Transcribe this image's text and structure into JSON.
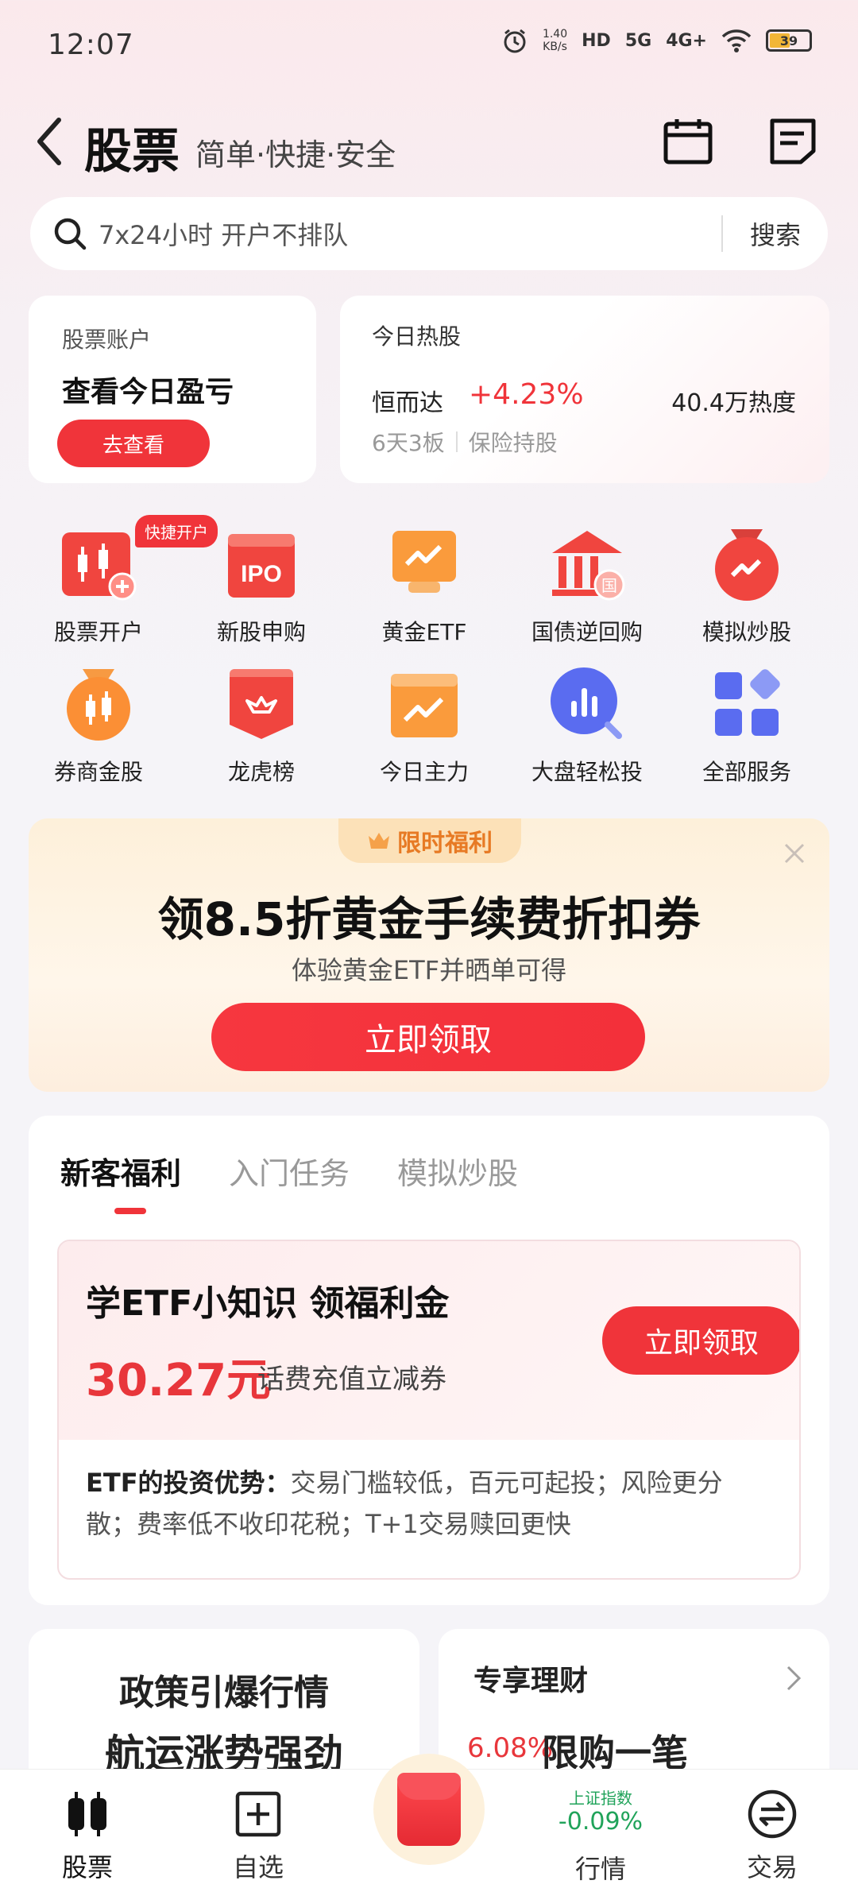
{
  "status_bar": {
    "time": "12:07",
    "net_speed": "1.40",
    "net_unit": "KB/s",
    "hd": "HD",
    "signal_5g": "5G",
    "signal_4g": "4G+",
    "battery": "39"
  },
  "header": {
    "title": "股票",
    "subtitle": "简单·快捷·安全"
  },
  "search": {
    "placeholder": "7x24小时 开户不排队",
    "button": "搜索"
  },
  "account_card": {
    "label": "股票账户",
    "value": "查看今日盈亏",
    "button": "去查看"
  },
  "hot_card": {
    "label": "今日热股",
    "stock_name": "恒而达",
    "change": "+4.23%",
    "heat": "40.4万热度",
    "streak": "6天3板",
    "tag": "保险持股"
  },
  "services": [
    {
      "label": "股票开户",
      "badge": "快捷开户",
      "icon": "candlestick-icon"
    },
    {
      "label": "新股申购",
      "icon": "ipo-icon",
      "icon_text": "IPO"
    },
    {
      "label": "黄金ETF",
      "icon": "gold-etf-icon"
    },
    {
      "label": "国债逆回购",
      "icon": "treasury-icon",
      "icon_text": "国"
    },
    {
      "label": "模拟炒股",
      "icon": "simulated-trading-icon"
    },
    {
      "label": "券商金股",
      "icon": "broker-stock-icon"
    },
    {
      "label": "龙虎榜",
      "icon": "dragon-tiger-icon"
    },
    {
      "label": "今日主力",
      "icon": "main-force-icon"
    },
    {
      "label": "大盘轻松投",
      "icon": "market-invest-icon"
    },
    {
      "label": "全部服务",
      "icon": "all-services-icon"
    }
  ],
  "promo": {
    "tab": "限时福利",
    "headline": "领8.5折黄金手续费折扣券",
    "sub": "体验黄金ETF并晒单可得",
    "button": "立即领取"
  },
  "welfare": {
    "tabs": [
      "新客福利",
      "入门任务",
      "模拟炒股"
    ],
    "title": "学ETF小知识 领福利金",
    "amount": "30.27元",
    "amount_note": "话费充值立减券",
    "button": "立即领取",
    "desc_bold": "ETF的投资优势：",
    "desc": "交易门槛较低，百元可起投；风险更分散；费率低不收印花税；T+1交易赎回更快"
  },
  "policy_card": {
    "line1": "政策引爆行情",
    "line2": "航运涨势强劲"
  },
  "finance_card": {
    "title": "专享理财",
    "rate": "6.08%",
    "limit": "限购一笔"
  },
  "bottom_nav": {
    "stocks": "股票",
    "watchlist": "自选",
    "market_index_name": "上证指数",
    "market_index_value": "-0.09%",
    "market": "行情",
    "trade": "交易"
  },
  "colors": {
    "accent": "#f0343a",
    "down_green": "#20a35a",
    "promo_orange": "#e77a24"
  }
}
